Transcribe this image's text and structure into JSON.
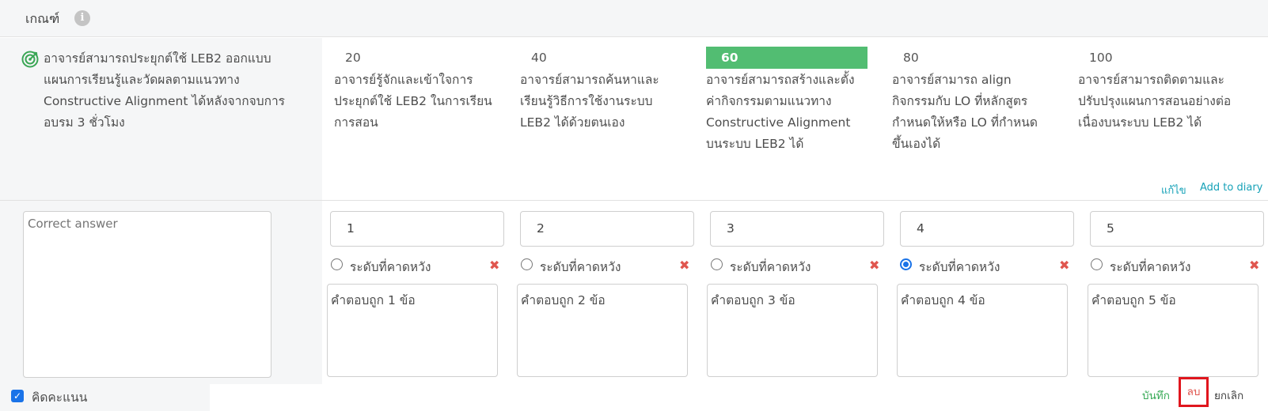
{
  "header": {
    "title": "เกณฑ์",
    "info_icon": "i"
  },
  "criterion": {
    "icon": "target-icon",
    "text": "อาจารย์สามารถประยุกต์ใช้ LEB2 ออกแบบแผนการเรียนรู้และวัดผลตามแนวทาง Constructive Alignment ได้หลังจากจบการอบรม 3 ชั่วโมง"
  },
  "levels": [
    {
      "score": "20",
      "description": "อาจารย์รู้จักและเข้าใจการประยุกต์ใช้ LEB2 ในการเรียนการสอน",
      "active": false
    },
    {
      "score": "40",
      "description": "อาจารย์สามารถค้นหาและเรียนรู้วิธีการใช้งานระบบ LEB2 ได้ด้วยตนเอง",
      "active": false
    },
    {
      "score": "60",
      "description": "อาจารย์สามารถสร้างและตั้งค่ากิจกรรมตามแนวทาง Constructive Alignment บนระบบ LEB2 ได้",
      "active": true
    },
    {
      "score": "80",
      "description": "อาจารย์สามารถ align กิจกรรมกับ LO ที่หลักสูตรกำหนดให้หรือ LO ที่กำหนดขึ้นเองได้",
      "active": false
    },
    {
      "score": "100",
      "description": "อาจารย์สามารถติดตามและปรับปรุงแผนการสอนอย่างต่อเนื่องบนระบบ LEB2 ได้",
      "active": false
    }
  ],
  "links": {
    "edit": "แก้ไข",
    "add_diary": "Add to diary"
  },
  "answer": {
    "correct_answer_placeholder": "Correct answer",
    "options": [
      {
        "score": "1",
        "radio_label": "ระดับที่คาดหวัง",
        "selected": false,
        "description": "คำตอบถูก 1 ข้อ"
      },
      {
        "score": "2",
        "radio_label": "ระดับที่คาดหวัง",
        "selected": false,
        "description": "คำตอบถูก 2 ข้อ"
      },
      {
        "score": "3",
        "radio_label": "ระดับที่คาดหวัง",
        "selected": false,
        "description": "คำตอบถูก 3 ข้อ"
      },
      {
        "score": "4",
        "radio_label": "ระดับที่คาดหวัง",
        "selected": true,
        "description": "คำตอบถูก 4 ข้อ"
      },
      {
        "score": "5",
        "radio_label": "ระดับที่คาดหวัง",
        "selected": false,
        "description": "คำตอบถูก 5 ข้อ"
      }
    ],
    "delete_icon": "✖"
  },
  "footer": {
    "checkbox_label": "คิดคะแนน",
    "checkbox_checked": true,
    "save": "บันทึก",
    "delete": "ลบ",
    "cancel": "ยกเลิก"
  },
  "colors": {
    "accent_green": "#52bd72",
    "link_teal": "#17a2b8",
    "delete_red": "#e0564f",
    "radio_blue": "#1a73e8"
  }
}
